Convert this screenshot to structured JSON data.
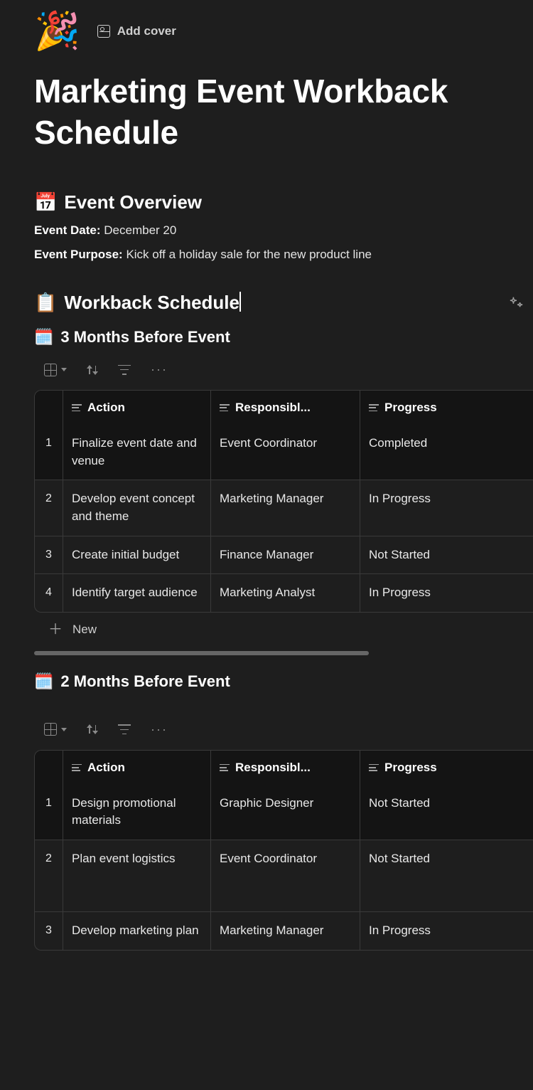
{
  "header": {
    "page_icon": "🎉",
    "add_cover_label": "Add cover",
    "title": "Marketing Event Workback Schedule"
  },
  "overview": {
    "icon": "📅",
    "heading": "Event Overview",
    "date_label": "Event Date:",
    "date_value": "December 20",
    "purpose_label": "Event Purpose:",
    "purpose_value": "Kick off a holiday sale for the new product line"
  },
  "workback": {
    "icon": "📋",
    "heading": "Workback Schedule"
  },
  "columns": {
    "action": "Action",
    "responsible": "Responsibl...",
    "progress": "Progress"
  },
  "new_row_label": "New",
  "section1": {
    "icon": "🗓️",
    "heading": "3 Months Before Event",
    "rows": [
      {
        "n": "1",
        "action": "Finalize event date and venue",
        "resp": "Event Coordinator",
        "prog": "Completed"
      },
      {
        "n": "2",
        "action": "Develop event concept and theme",
        "resp": "Marketing Manager",
        "prog": "In Progress"
      },
      {
        "n": "3",
        "action": "Create initial budget",
        "resp": "Finance Manager",
        "prog": "Not Started"
      },
      {
        "n": "4",
        "action": "Identify target audience",
        "resp": "Marketing Analyst",
        "prog": "In Progress"
      }
    ]
  },
  "section2": {
    "icon": "🗓️",
    "heading": "2 Months Before Event",
    "rows": [
      {
        "n": "1",
        "action": "Design promotional materials",
        "resp": "Graphic Designer",
        "prog": "Not Started"
      },
      {
        "n": "2",
        "action": "Plan event logistics",
        "resp": "Event Coordinator",
        "prog": "Not Started"
      },
      {
        "n": "3",
        "action": "Develop marketing plan",
        "resp": "Marketing Manager",
        "prog": "In Progress"
      }
    ]
  }
}
